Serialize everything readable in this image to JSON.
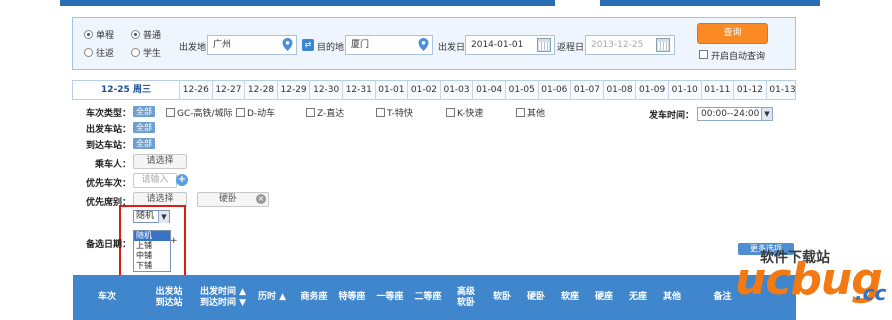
{
  "search": {
    "trip_type": {
      "single": "单程",
      "round": "往返"
    },
    "passenger_type": {
      "normal": "普通",
      "student": "学生"
    },
    "from_label": "出发地",
    "from_value": "广州",
    "to_label": "目的地",
    "to_value": "厦门",
    "depart_label": "出发日",
    "depart_value": "2014-01-01",
    "return_label": "返程日",
    "return_value": "2013-12-25",
    "query_button": "查询",
    "auto_query_label": "开启自动查询"
  },
  "date_tabs": [
    "12-25 周三",
    "12-26",
    "12-27",
    "12-28",
    "12-29",
    "12-30",
    "12-31",
    "01-01",
    "01-02",
    "01-03",
    "01-04",
    "01-05",
    "01-06",
    "01-07",
    "01-08",
    "01-09",
    "01-10",
    "01-11",
    "01-12",
    "01-13"
  ],
  "filters": {
    "train_type_label": "车次类型：",
    "all_tag": "全部",
    "train_types": [
      "GC-高铁/城际",
      "D-动车",
      "Z-直达",
      "T-特快",
      "K-快速",
      "其他"
    ],
    "depart_station_label": "出发车站：",
    "arrive_station_label": "到达车站：",
    "depart_time_label": "发车时间：",
    "depart_time_value": "00:00--24:00",
    "passenger_label": "乘车人：",
    "passenger_placeholder": "请选择",
    "priority_train_label": "优先车次：",
    "priority_train_placeholder": "请输入",
    "priority_seat_label": "优先席别：",
    "priority_seat_placeholder": "请选择",
    "selected_seat": "硬卧",
    "berth_current": "随机",
    "berth_options": [
      "随机",
      "上铺",
      "中铺",
      "下铺"
    ],
    "backup_date_label": "备选日期：",
    "backup_date_suffix": "+",
    "more_button": "更多选项"
  },
  "table_headers": [
    {
      "line1": "车次",
      "line2": ""
    },
    {
      "line1": "出发站",
      "line2": "到达站"
    },
    {
      "line1": "出发时间 ▲",
      "line2": "到达时间 ▼"
    },
    {
      "line1": "历时 ▲",
      "line2": ""
    },
    {
      "line1": "商务座",
      "line2": ""
    },
    {
      "line1": "特等座",
      "line2": ""
    },
    {
      "line1": "一等座",
      "line2": ""
    },
    {
      "line1": "二等座",
      "line2": ""
    },
    {
      "line1": "高级",
      "line2": "软卧"
    },
    {
      "line1": "软卧",
      "line2": ""
    },
    {
      "line1": "硬卧",
      "line2": ""
    },
    {
      "line1": "软座",
      "line2": ""
    },
    {
      "line1": "硬座",
      "line2": ""
    },
    {
      "line1": "无座",
      "line2": ""
    },
    {
      "line1": "其他",
      "line2": ""
    },
    {
      "line1": "备注",
      "line2": ""
    }
  ],
  "watermark": {
    "cn": "软件下载站",
    "logo": "ucbug",
    "tld": ".cc"
  },
  "colors": {
    "accent": "#3f86cc",
    "query": "#fb8a24",
    "highlight": "#e01919"
  }
}
